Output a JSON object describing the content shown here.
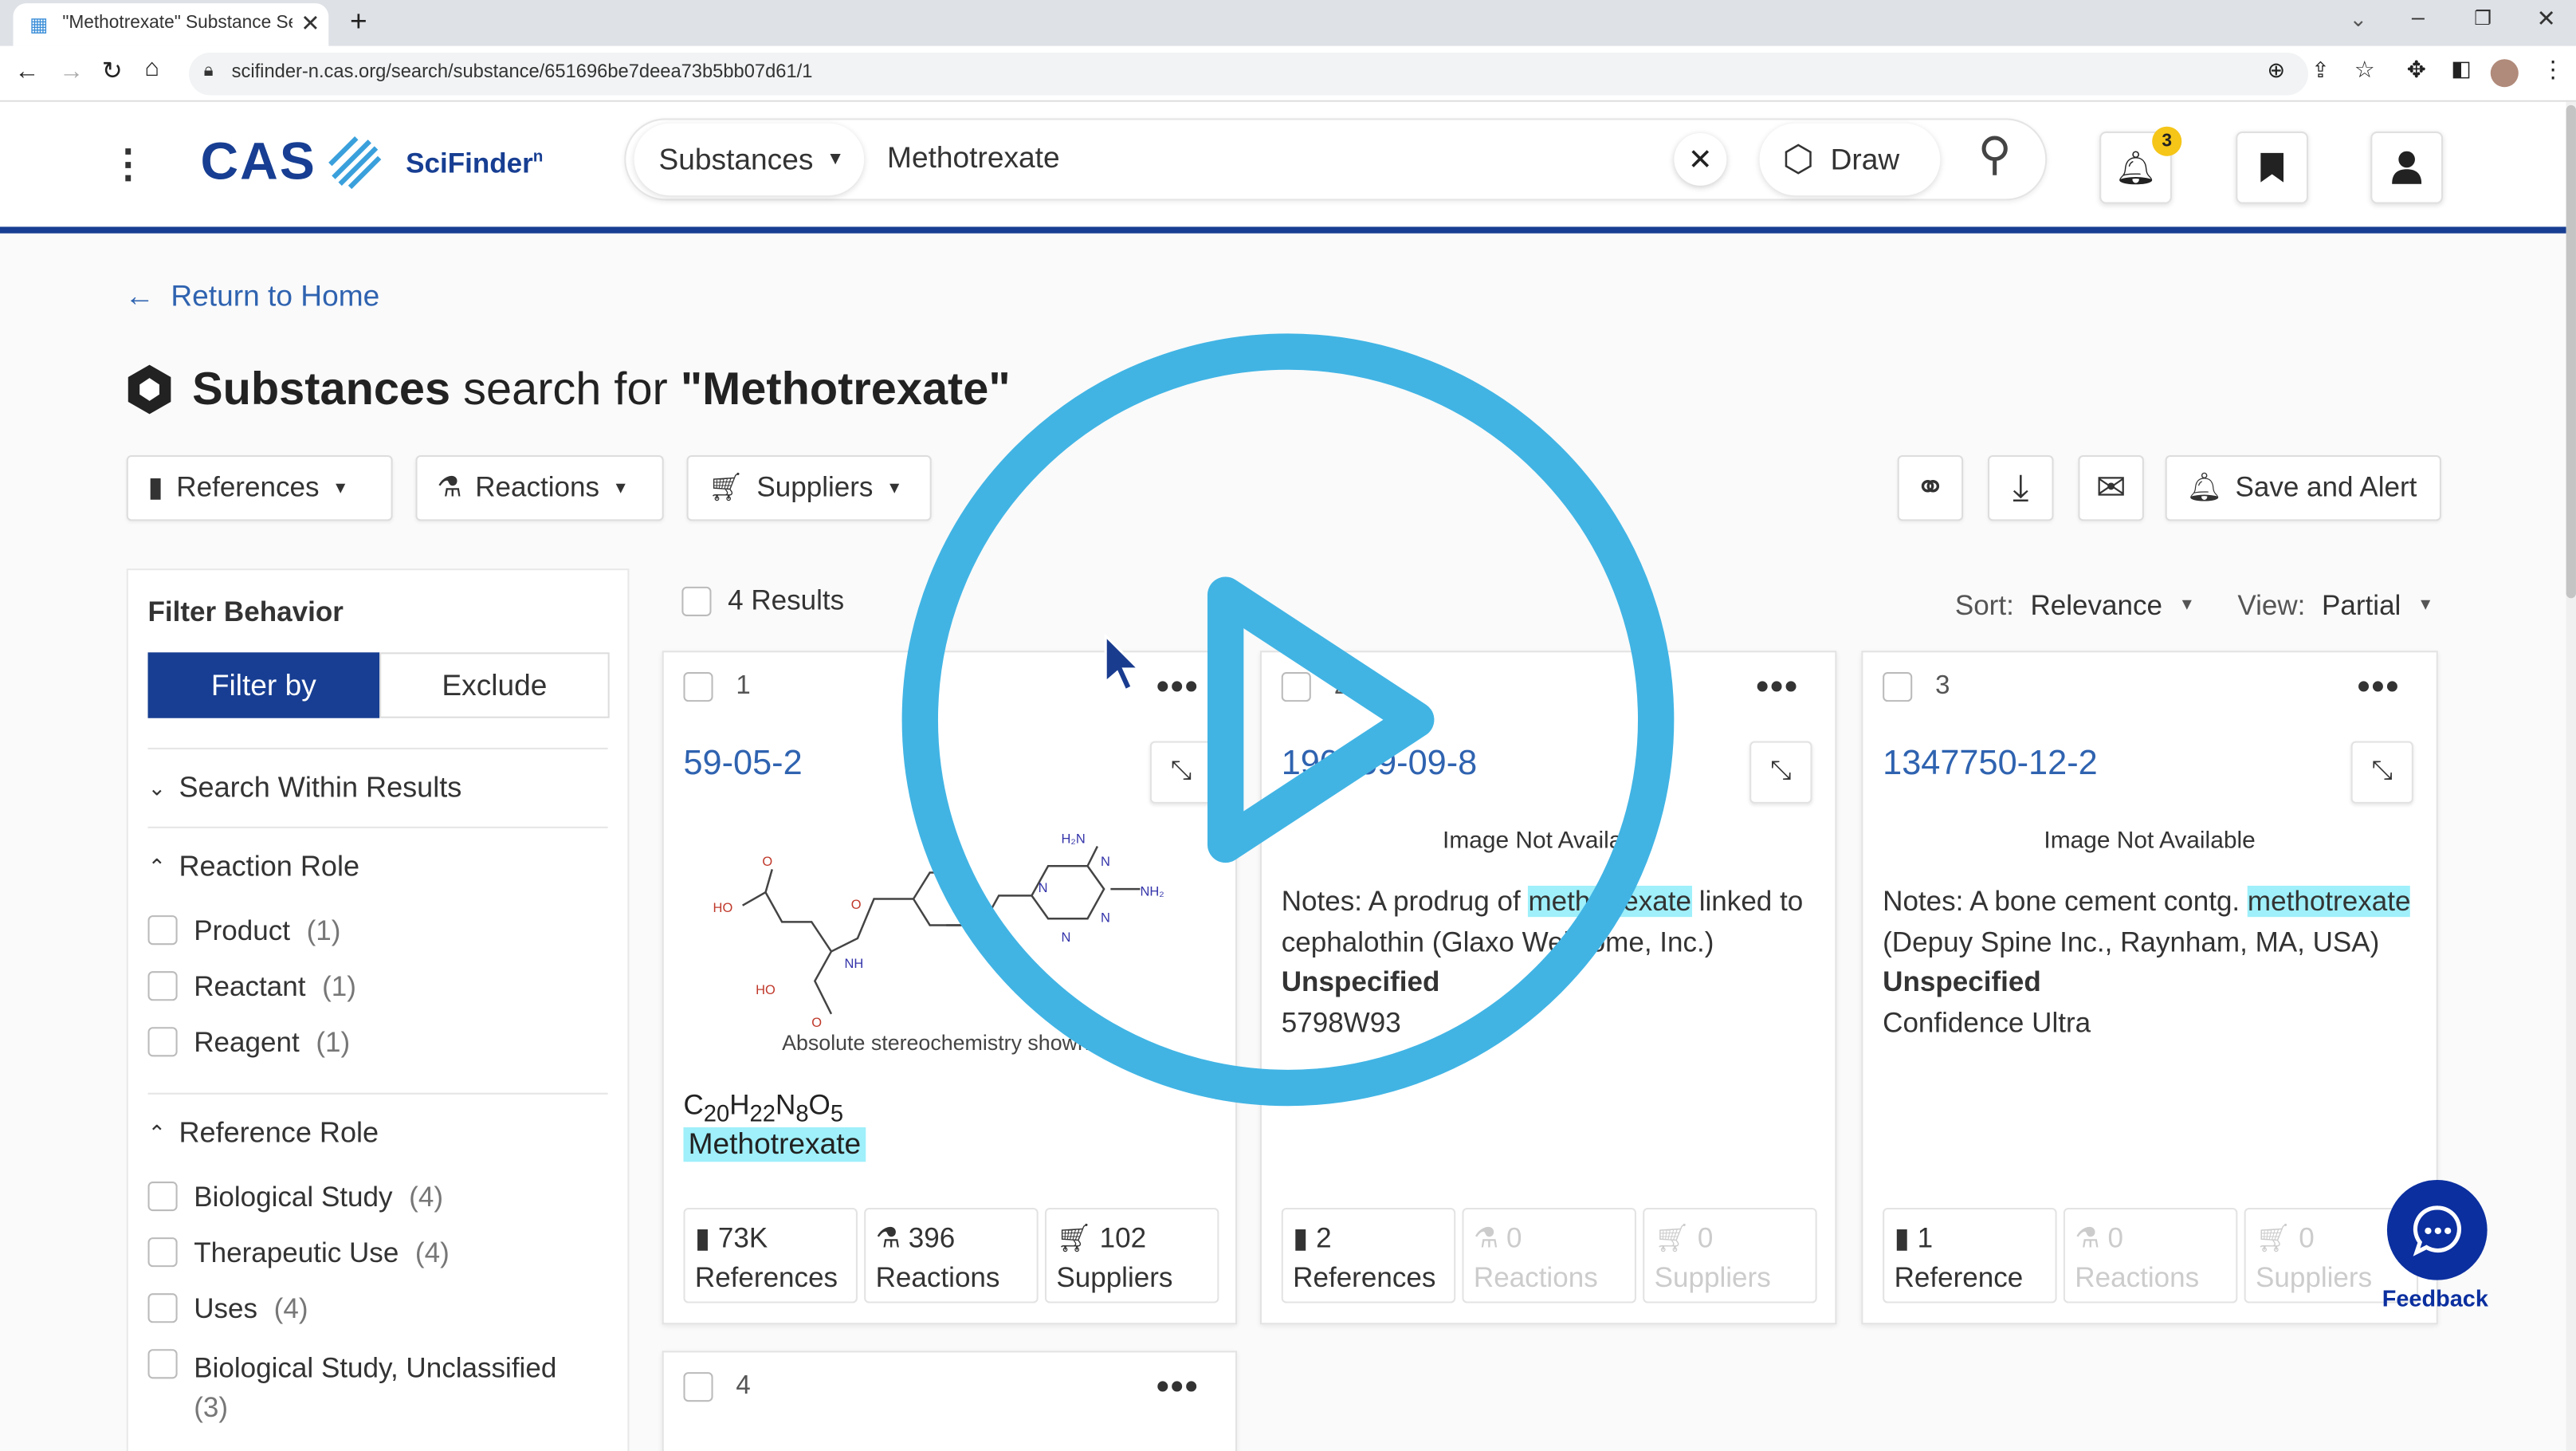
{
  "browser": {
    "tab_title": "\"Methotrexate\" Substance Search",
    "url": "scifinder-n.cas.org/search/substance/651696be7deea73b5bb07d61/1"
  },
  "header": {
    "logo_text": "CAS",
    "product": "SciFinder",
    "product_sup": "n",
    "search_type": "Substances",
    "search_value": "Methotrexate",
    "draw_label": "Draw",
    "notification_count": "3"
  },
  "nav": {
    "return_home": "Return to Home"
  },
  "title": {
    "bold": "Substances",
    "rest": " search for ",
    "query": "\"Methotrexate\""
  },
  "toolbar": {
    "references": "References",
    "reactions": "Reactions",
    "suppliers": "Suppliers",
    "save_alert": "Save and Alert"
  },
  "filters": {
    "behavior_title": "Filter Behavior",
    "filter_by": "Filter by",
    "exclude": "Exclude",
    "search_within": "Search Within Results",
    "reaction_role": {
      "title": "Reaction Role",
      "items": [
        {
          "label": "Product",
          "count": "(1)"
        },
        {
          "label": "Reactant",
          "count": "(1)"
        },
        {
          "label": "Reagent",
          "count": "(1)"
        }
      ]
    },
    "reference_role": {
      "title": "Reference Role",
      "items": [
        {
          "label": "Biological Study",
          "count": "(4)"
        },
        {
          "label": "Therapeutic Use",
          "count": "(4)"
        },
        {
          "label": "Uses",
          "count": "(4)"
        },
        {
          "label": "Biological Study, Unclassified",
          "count": "(3)"
        }
      ]
    }
  },
  "results": {
    "count_label": "4 Results",
    "sort_label": "Sort:",
    "sort_value": "Relevance",
    "view_label": "View:",
    "view_value": "Partial",
    "cards": [
      {
        "index": "1",
        "cas": "59-05-2",
        "stereo_note": "Absolute stereochemistry shown",
        "formula": {
          "c": "20",
          "h": "22",
          "n": "8",
          "o": "5"
        },
        "name": "Methotrexate",
        "references": "73K",
        "references_label": "References",
        "reactions": "396",
        "reactions_label": "Reactions",
        "suppliers": "102",
        "suppliers_label": "Suppliers"
      },
      {
        "index": "2",
        "cas": "190159-09-8",
        "image_note": "Image Not Available",
        "notes_pre": "Notes: A prodrug of ",
        "notes_hl": "methotrexate",
        "notes_post": " linked to cephalothin (Glaxo Wellcome, Inc.)",
        "type": "Unspecified",
        "extra": "5798W93",
        "references": "2",
        "references_label": "References",
        "reactions": "0",
        "reactions_label": "Reactions",
        "suppliers": "0",
        "suppliers_label": "Suppliers"
      },
      {
        "index": "3",
        "cas": "1347750-12-2",
        "image_note": "Image Not Available",
        "notes_pre": "Notes: A bone cement contg. ",
        "notes_hl": "methotrexate",
        "notes_post": " (Depuy Spine Inc., Raynham, MA, USA)",
        "type": "Unspecified",
        "extra": "Confidence Ultra",
        "references": "1",
        "references_label": "Reference",
        "reactions": "0",
        "reactions_label": "Reactions",
        "suppliers": "0",
        "suppliers_label": "Suppliers"
      },
      {
        "index": "4"
      }
    ]
  },
  "feedback": {
    "label": "Feedback"
  },
  "colors": {
    "brand_blue": "#173e92",
    "link": "#2f63b0",
    "highlight": "#9ff0fa",
    "play_overlay": "#41b4e4",
    "badge": "#f5c518"
  }
}
